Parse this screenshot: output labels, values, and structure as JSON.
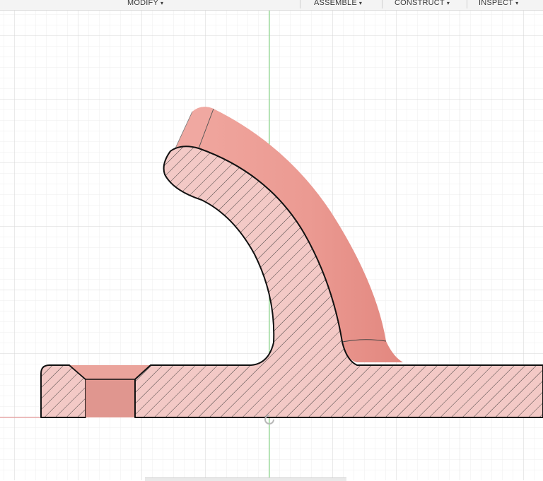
{
  "toolbar": {
    "modify": "MODIFY",
    "assemble": "ASSEMBLE",
    "construct": "CONSTRUCT",
    "inspect": "INSPECT",
    "caret": "▾"
  },
  "colors": {
    "grid_minor": "#eeeeee",
    "grid_major": "#d6d6d6",
    "axis_green": "#7ad67a",
    "axis_red": "#e88a8a",
    "body_fill": "#f3c9c6",
    "surface_fill": "#eb9a92",
    "outline": "#111111",
    "hatch": "#333333"
  },
  "icons": {
    "caret": "chevron-down-icon",
    "origin": "origin-icon"
  }
}
